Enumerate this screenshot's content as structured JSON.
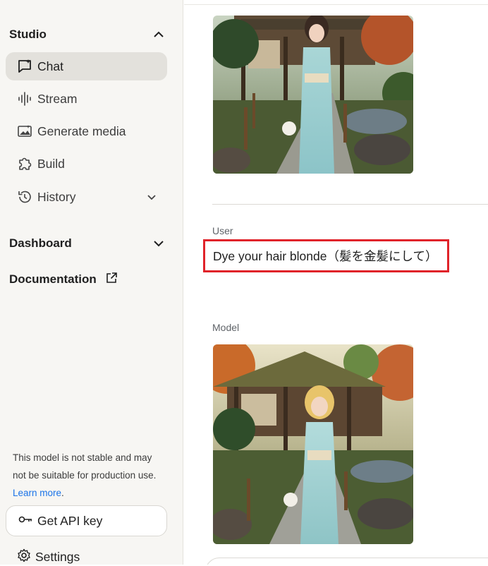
{
  "sidebar": {
    "studio": {
      "label": "Studio"
    },
    "nav_items": [
      {
        "label": "Chat",
        "icon": "chat-icon",
        "active": true
      },
      {
        "label": "Stream",
        "icon": "waveform-icon"
      },
      {
        "label": "Generate media",
        "icon": "image-icon"
      },
      {
        "label": "Build",
        "icon": "puzzle-icon"
      },
      {
        "label": "History",
        "icon": "history-icon"
      }
    ],
    "dashboard": {
      "label": "Dashboard"
    },
    "documentation": {
      "label": "Documentation"
    },
    "notice": {
      "text": "This model is not stable and may not be suitable for production use.",
      "link": "Learn more"
    },
    "api_key_button": {
      "label": "Get API key",
      "icon": "key-icon"
    },
    "settings": {
      "label": "Settings",
      "icon": "gear-icon"
    }
  },
  "conversation": {
    "messages": [
      {
        "role": "User",
        "text": "Dye your hair blonde（髪を金髪にして）",
        "highlight_color": "#e0232a"
      },
      {
        "role": "Model"
      }
    ]
  },
  "colors": {
    "sidebar_bg": "#f7f6f3",
    "active_item_bg": "#e3e1dc",
    "link": "#1a73e8",
    "highlight": "#e0232a"
  }
}
